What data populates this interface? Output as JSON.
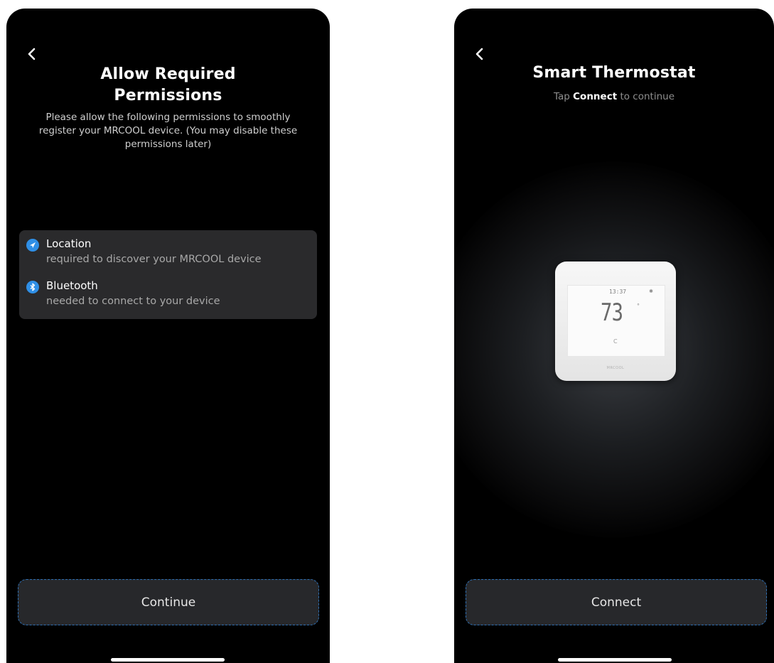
{
  "permissions_screen": {
    "title": "Allow Required Permissions",
    "description": "Please allow the following permissions to smoothly register your MRCOOL device. (You may disable these permissions later)",
    "permissions": [
      {
        "title": "Location",
        "description": "required to discover your MRCOOL device",
        "icon": "location-arrow-icon"
      },
      {
        "title": "Bluetooth",
        "description": "needed to connect to your device",
        "icon": "bluetooth-icon"
      }
    ],
    "continue_label": "Continue"
  },
  "connect_screen": {
    "title": "Smart Thermostat",
    "subtitle_prefix": "Tap",
    "subtitle_bold": "Connect",
    "subtitle_suffix": "to continue",
    "thermostat": {
      "time": "13:37",
      "temperature": "73",
      "mode": "C",
      "brand": "MRCOOL"
    },
    "connect_label": "Connect"
  },
  "colors": {
    "background": "#000000",
    "card": "#2a2a2c",
    "button": "#27282b",
    "accent": "#2f8fe6"
  }
}
